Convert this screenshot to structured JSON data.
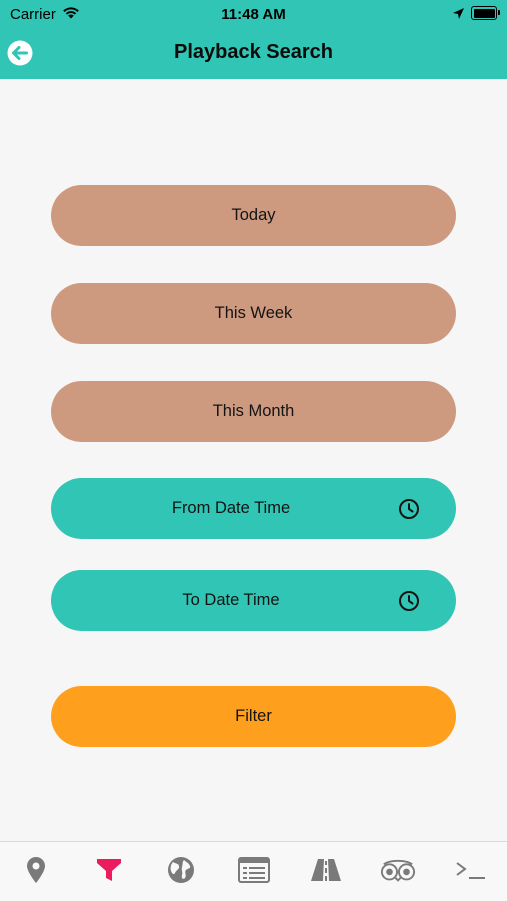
{
  "status_bar": {
    "carrier": "Carrier",
    "time": "11:48 AM"
  },
  "header": {
    "title": "Playback Search",
    "back_icon": "arrow-left-circle-icon"
  },
  "buttons": {
    "today": "Today",
    "this_week": "This Week",
    "this_month": "This Month",
    "from_date_time": "From Date Time",
    "to_date_time": "To Date Time",
    "filter": "Filter"
  },
  "tabs": [
    {
      "icon": "map-pin-icon",
      "active": false
    },
    {
      "icon": "filter-icon",
      "active": true
    },
    {
      "icon": "globe-icon",
      "active": false
    },
    {
      "icon": "list-icon",
      "active": false
    },
    {
      "icon": "road-icon",
      "active": false
    },
    {
      "icon": "tripadvisor-icon",
      "active": false
    },
    {
      "icon": "terminal-icon",
      "active": false
    }
  ],
  "colors": {
    "header": "#30c5b4",
    "tan_button": "#cd9a80",
    "teal_button": "#30c5b4",
    "filter_button": "#ff9f1e",
    "active_tab": "#ea1c5e",
    "inactive_tab": "#7a7a7a"
  }
}
